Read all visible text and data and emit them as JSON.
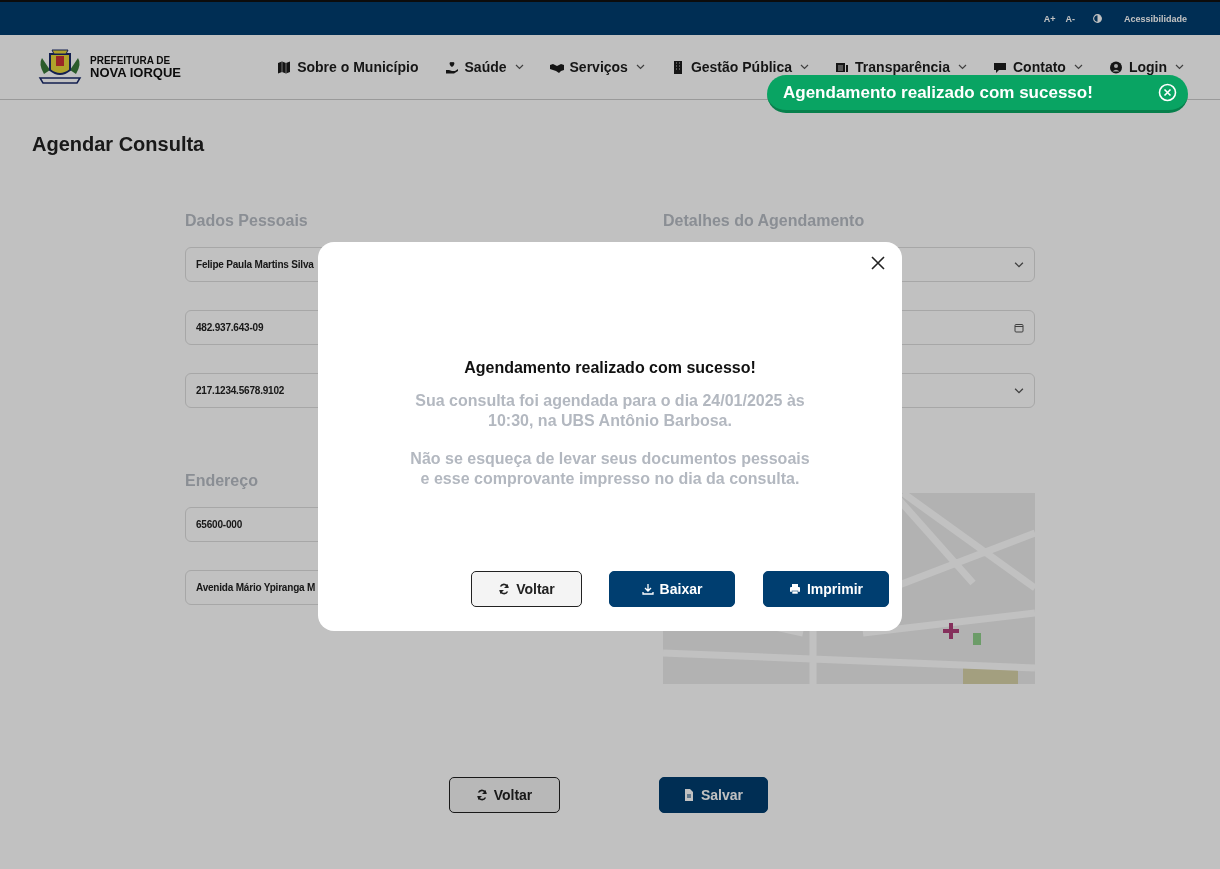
{
  "top_bar": {
    "font_controls": [
      "A+",
      "A-"
    ],
    "accessibility": "Acessibilidade"
  },
  "header": {
    "logo": {
      "line1": "PREFEITURA DE",
      "line2": "NOVA IORQUE"
    },
    "nav": [
      {
        "label": "Sobre o Município",
        "has_menu": false
      },
      {
        "label": "Saúde",
        "has_menu": true
      },
      {
        "label": "Serviços",
        "has_menu": true
      },
      {
        "label": "Gestão Pública",
        "has_menu": true
      },
      {
        "label": "Transparência",
        "has_menu": true
      },
      {
        "label": "Contato",
        "has_menu": true
      },
      {
        "label": "Login",
        "has_menu": true
      }
    ]
  },
  "page_title": "Agendar Consulta",
  "personal": {
    "heading": "Dados Pessoais",
    "fields": [
      {
        "value": "Felipe Paula Martins Silva"
      },
      {
        "value": "482.937.643-09"
      },
      {
        "value": "217.1234.5678.9102"
      }
    ]
  },
  "appointment": {
    "heading": "Detalhes do Agendamento",
    "fields": [
      {
        "kind": "select"
      },
      {
        "kind": "date"
      },
      {
        "kind": "select"
      }
    ]
  },
  "address": {
    "heading": "Endereço",
    "fields": [
      {
        "value": "65600-000"
      },
      {
        "value": "Avenida Mário Ypiranga M"
      }
    ]
  },
  "actions": [
    {
      "label": "Voltar",
      "kind": "outline"
    },
    {
      "label": "Salvar",
      "kind": "primary"
    }
  ],
  "modal": {
    "title": "Agendamento realizado com sucesso!",
    "paragraphs": [
      "Sua consulta foi agendada para o dia 24/01/2025 às 10:30, na UBS Antônio Barbosa.",
      "Não se esqueça de levar seus documentos pessoais e esse comprovante impresso no dia da consulta."
    ],
    "buttons": [
      {
        "label": "Voltar",
        "kind": "outline"
      },
      {
        "label": "Baixar",
        "kind": "download"
      },
      {
        "label": "Imprimir",
        "kind": "print"
      }
    ]
  },
  "toast": {
    "text": "Agendamento realizado com sucesso!"
  }
}
